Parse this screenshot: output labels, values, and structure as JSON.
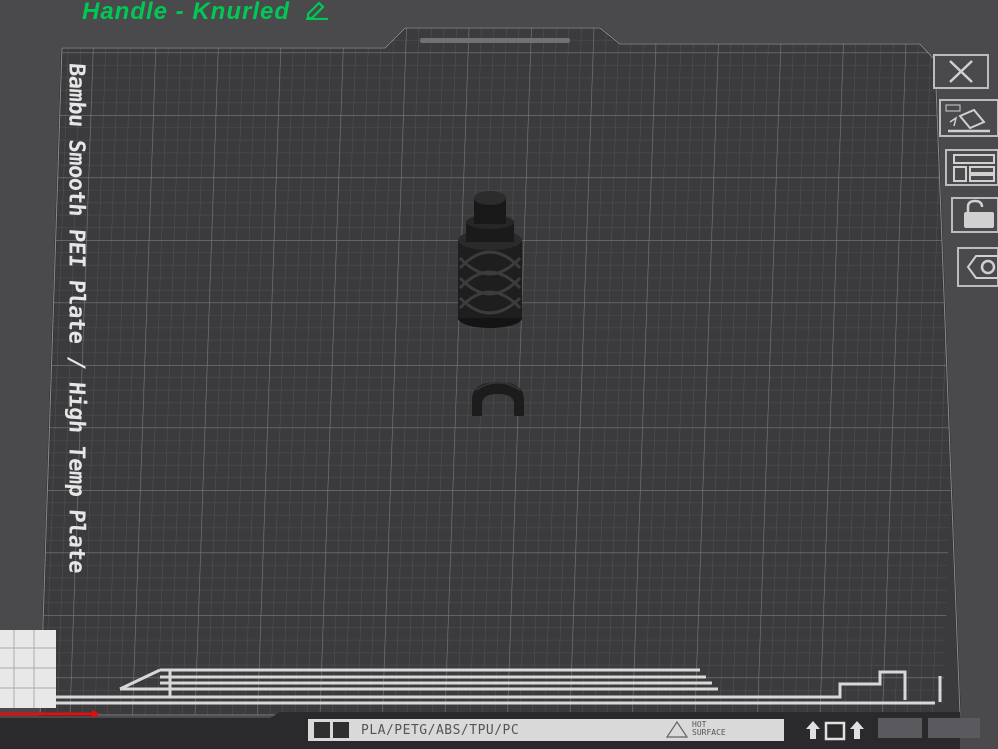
{
  "project": {
    "title": "Handle - Knurled"
  },
  "plate": {
    "label": "Bambu Smooth PEI Plate / High Temp Plate",
    "materials": "PLA/PETG/ABS/TPU/PC",
    "warning": "HOT\nSURFACE"
  },
  "toolbar": {
    "buttons": [
      {
        "name": "close-plate-icon"
      },
      {
        "name": "auto-orient-icon"
      },
      {
        "name": "arrange-icon"
      },
      {
        "name": "lock-icon"
      },
      {
        "name": "settings-icon"
      }
    ]
  },
  "colors": {
    "title": "#00c853",
    "background": "#4a4a4d",
    "plate": "#3a3a3d",
    "grid": "#6b6b70",
    "object": "#1c1c1c"
  }
}
